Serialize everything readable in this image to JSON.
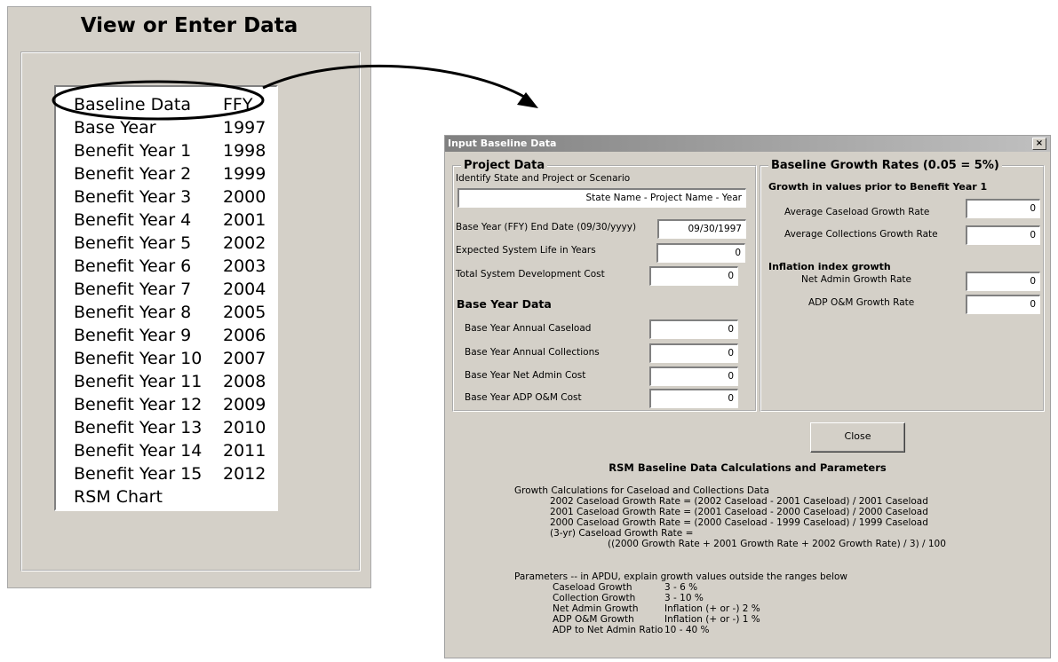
{
  "left_panel": {
    "title": "View or Enter Data",
    "list_items": [
      {
        "label": "Baseline Data",
        "value": "FFY"
      },
      {
        "label": "Base Year",
        "value": "1997"
      },
      {
        "label": "Benefit Year 1",
        "value": "1998"
      },
      {
        "label": "Benefit Year 2",
        "value": "1999"
      },
      {
        "label": "Benefit Year 3",
        "value": "2000"
      },
      {
        "label": "Benefit Year 4",
        "value": "2001"
      },
      {
        "label": "Benefit Year 5",
        "value": "2002"
      },
      {
        "label": "Benefit Year 6",
        "value": "2003"
      },
      {
        "label": "Benefit Year 7",
        "value": "2004"
      },
      {
        "label": "Benefit Year 8",
        "value": "2005"
      },
      {
        "label": "Benefit Year 9",
        "value": "2006"
      },
      {
        "label": "Benefit Year 10",
        "value": "2007"
      },
      {
        "label": "Benefit Year 11",
        "value": "2008"
      },
      {
        "label": "Benefit Year 12",
        "value": "2009"
      },
      {
        "label": "Benefit Year 13",
        "value": "2010"
      },
      {
        "label": "Benefit Year 14",
        "value": "2011"
      },
      {
        "label": "Benefit Year 15",
        "value": "2012"
      },
      {
        "label": "RSM Chart",
        "value": ""
      }
    ]
  },
  "dialog": {
    "title": "Input Baseline Data",
    "close_x": "×",
    "project": {
      "group_title": "Project Data",
      "identify_label": "Identify State and Project or Scenario",
      "identify_value": "State Name - Project Name - Year",
      "base_year_label": "Base Year (FFY) End Date (09/30/yyyy)",
      "base_year_value": "09/30/1997",
      "life_label": "Expected System Life in Years",
      "life_value": "0",
      "dev_cost_label": "Total System Development Cost",
      "dev_cost_value": "0",
      "base_year_data_title": "Base Year Data",
      "caseload_label": "Base Year Annual Caseload",
      "caseload_value": "0",
      "collections_label": "Base Year Annual Collections",
      "collections_value": "0",
      "net_admin_label": "Base Year Net Admin Cost",
      "net_admin_value": "0",
      "adp_label": "Base Year ADP O&M Cost",
      "adp_value": "0"
    },
    "growth": {
      "group_title": "Baseline Growth Rates (0.05 = 5%)",
      "prior_title": "Growth in values prior to Benefit Year 1",
      "caseload_label": "Average Caseload Growth Rate",
      "caseload_value": "0",
      "collections_label": "Average Collections Growth Rate",
      "collections_value": "0",
      "inflation_title": "Inflation index growth",
      "net_admin_label": "Net Admin Growth Rate",
      "net_admin_value": "0",
      "adp_label": "ADP O&M Growth Rate",
      "adp_value": "0"
    },
    "close_button": "Close",
    "calc": {
      "title": "RSM Baseline Data Calculations and Parameters",
      "lines": [
        "Growth Calculations for Caseload and Collections Data",
        "2002 Caseload Growth Rate = (2002 Caseload - 2001 Caseload) / 2001 Caseload",
        "2001 Caseload Growth Rate = (2001 Caseload - 2000 Caseload) / 2000 Caseload",
        "2000 Caseload Growth Rate = (2000 Caseload - 1999 Caseload) / 1999 Caseload",
        "(3-yr) Caseload Growth Rate =",
        "((2000 Growth Rate + 2001 Growth Rate + 2002 Growth Rate) / 3) / 100"
      ],
      "params_intro": "Parameters -- in APDU, explain growth values outside the ranges below",
      "params": [
        {
          "name": "Caseload Growth",
          "range": "3 - 6 %"
        },
        {
          "name": "Collection Growth",
          "range": "3 - 10 %"
        },
        {
          "name": "Net Admin Growth",
          "range": "Inflation (+ or -) 2 %"
        },
        {
          "name": "ADP O&M Growth",
          "range": "Inflation (+ or -) 1 %"
        },
        {
          "name": "ADP to Net Admin Ratio",
          "range": "10 - 40 %"
        }
      ]
    }
  }
}
